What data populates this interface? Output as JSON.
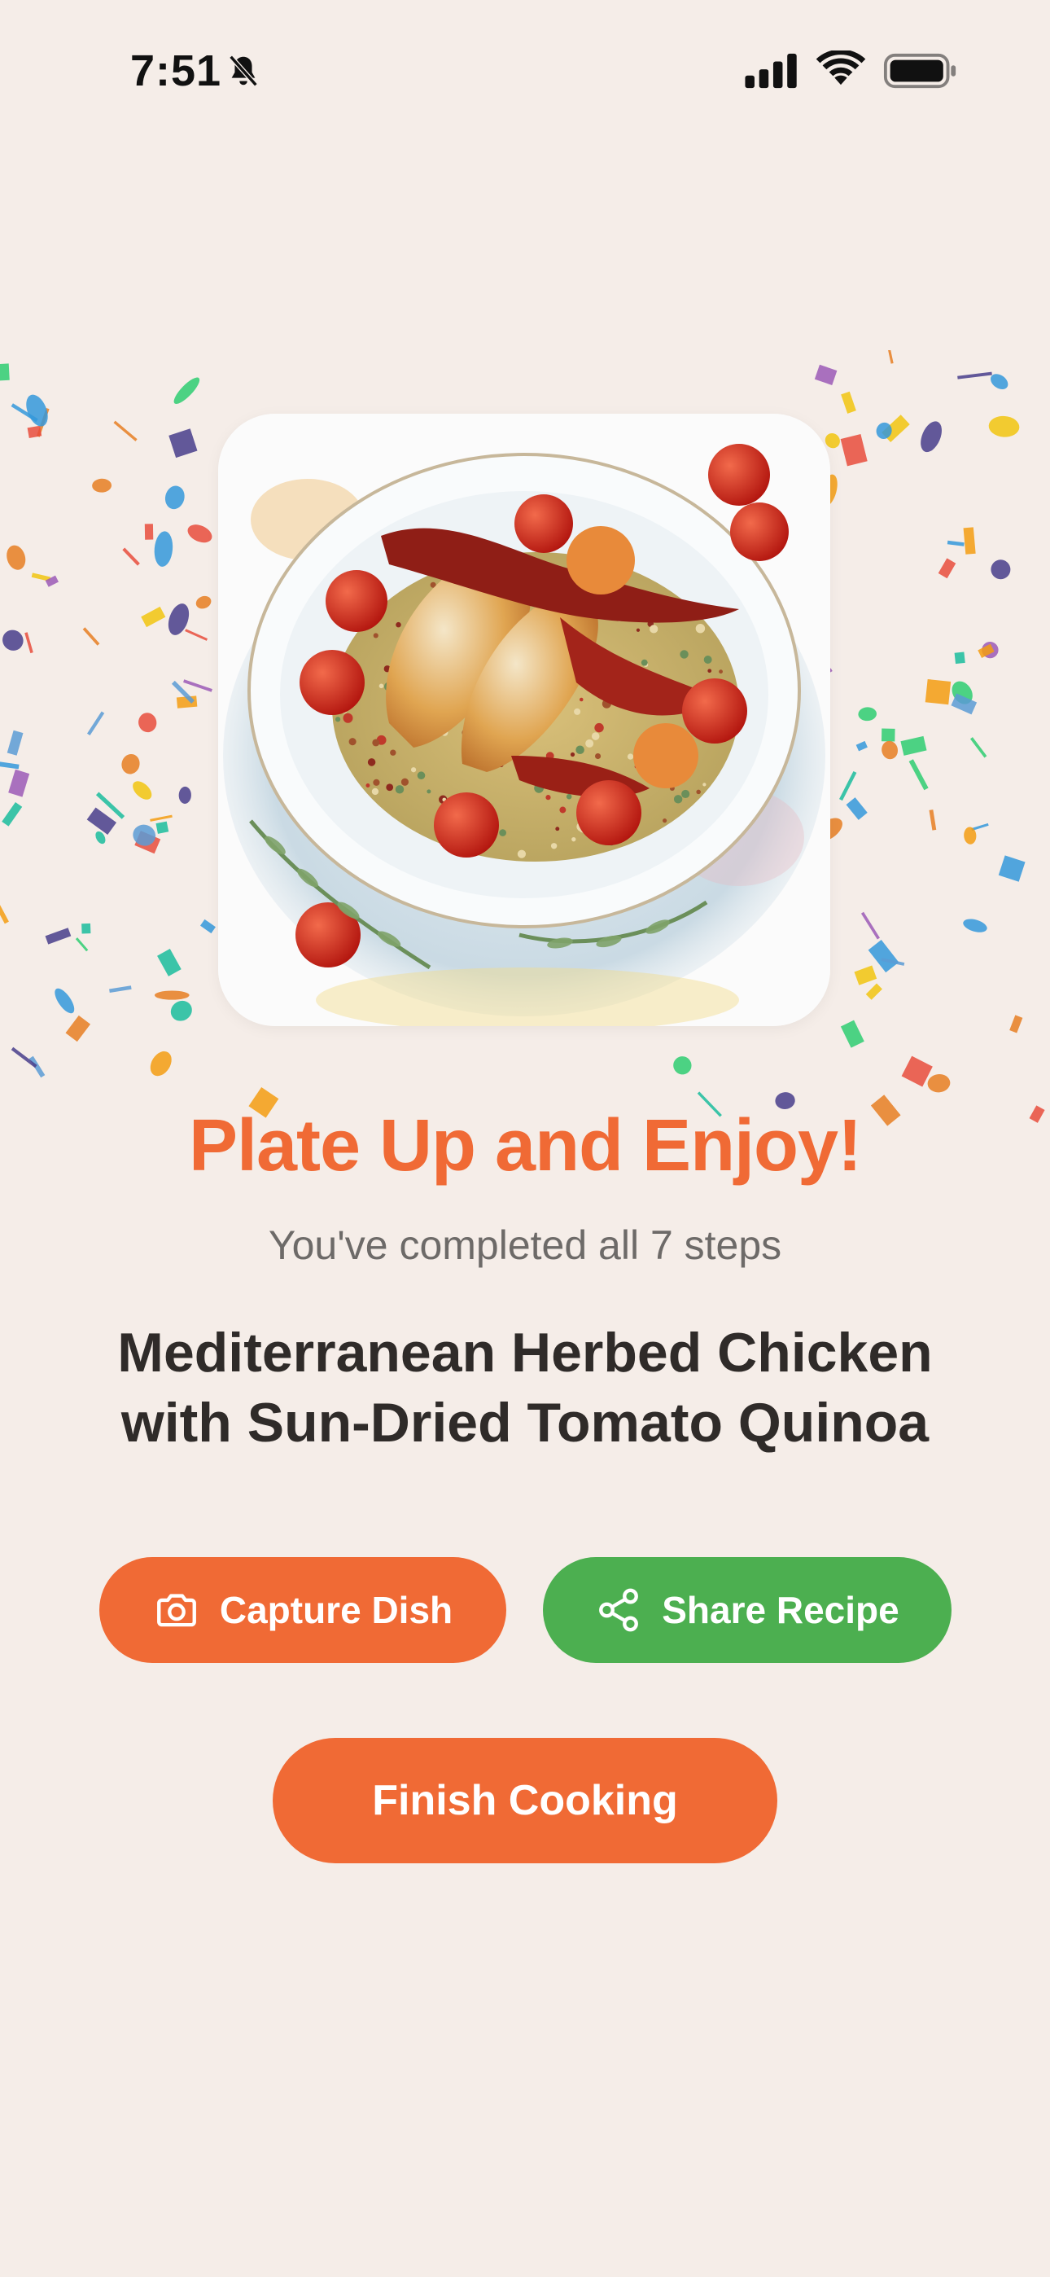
{
  "status_bar": {
    "time": "7:51",
    "icons": [
      "bell-slash-icon",
      "cellular-signal-icon",
      "wifi-icon",
      "battery-icon"
    ]
  },
  "hero": {
    "image_alt": "Watercolor illustration of herbed chicken with sun-dried tomatoes and quinoa",
    "confetti_colors": [
      "#e74c3c",
      "#f39c12",
      "#2ecc71",
      "#3498db",
      "#9b59b6",
      "#1abc9c",
      "#e67e22",
      "#f1c40f",
      "#5b9bd5",
      "#483d8b"
    ]
  },
  "content": {
    "headline": "Plate Up and Enjoy!",
    "subline": "You've completed all 7 steps",
    "recipe_title_line1": "Mediterranean Herbed Chicken",
    "recipe_title_line2": "with Sun-Dried Tomato Quinoa"
  },
  "actions": {
    "capture_label": "Capture Dish",
    "share_label": "Share Recipe",
    "finish_label": "Finish Cooking"
  },
  "colors": {
    "background": "#f5ede8",
    "accent_orange": "#f06a35",
    "accent_green": "#4caf50",
    "title_text": "#2f2b29",
    "subtle_text": "#6d6a68"
  }
}
